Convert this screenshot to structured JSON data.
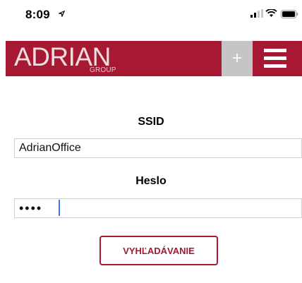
{
  "status_bar": {
    "time": "8:09"
  },
  "header": {
    "brand": "ADRIAN",
    "brand_sub": "GROUP",
    "plus_label": "+"
  },
  "form": {
    "ssid_label": "SSID",
    "ssid_value": "AdrianOffice",
    "password_label": "Heslo",
    "password_value": "abcd",
    "search_button": "VYHĽADÁVANIE"
  },
  "colors": {
    "brand": "#a71932",
    "plus_bg": "#c7c4c5",
    "caret": "#3478f6"
  }
}
